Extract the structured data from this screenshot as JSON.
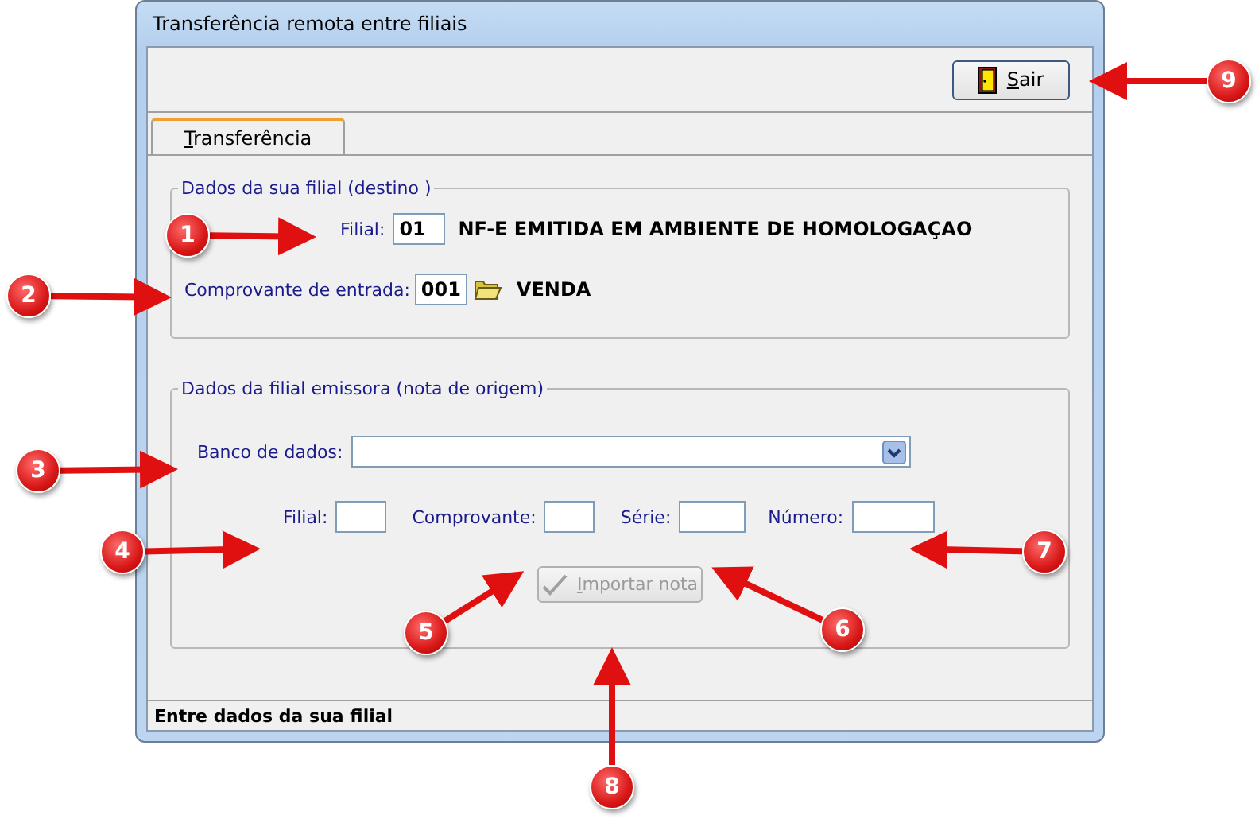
{
  "window": {
    "title": "Transferência remota entre filiais"
  },
  "toolbar": {
    "exit_button": {
      "mnemonic": "S",
      "rest": "air",
      "disabled": false
    }
  },
  "tabs": [
    {
      "mnemonic": "T",
      "rest": "ransferência",
      "selected": true
    }
  ],
  "destination_group": {
    "legend": "Dados da sua filial (destino )",
    "branch": {
      "label": "Filial:",
      "value": "01",
      "description": "NF-E EMITIDA EM AMBIENTE DE HOMOLOGAÇAO"
    },
    "voucher": {
      "label": "Comprovante de entrada:",
      "value": "001",
      "description": "VENDA"
    }
  },
  "source_group": {
    "legend": "Dados da filial emissora (nota de origem)",
    "database": {
      "label": "Banco de dados:"
    },
    "fields": [
      {
        "label": "Filial:",
        "kind": "narrow"
      },
      {
        "label": "Comprovante:",
        "kind": "narrow"
      },
      {
        "label": "Série:",
        "kind": "medium"
      },
      {
        "label": "Número:",
        "kind": "wide"
      }
    ],
    "import_button": {
      "mnemonic": "I",
      "rest": "mportar nota",
      "disabled": true
    }
  },
  "status_bar": {
    "text": "Entre dados da sua filial"
  },
  "callouts": [
    {
      "number": "1"
    },
    {
      "number": "2"
    },
    {
      "number": "3"
    },
    {
      "number": "4"
    },
    {
      "number": "5"
    },
    {
      "number": "6"
    },
    {
      "number": "7"
    },
    {
      "number": "8"
    },
    {
      "number": "9"
    }
  ]
}
